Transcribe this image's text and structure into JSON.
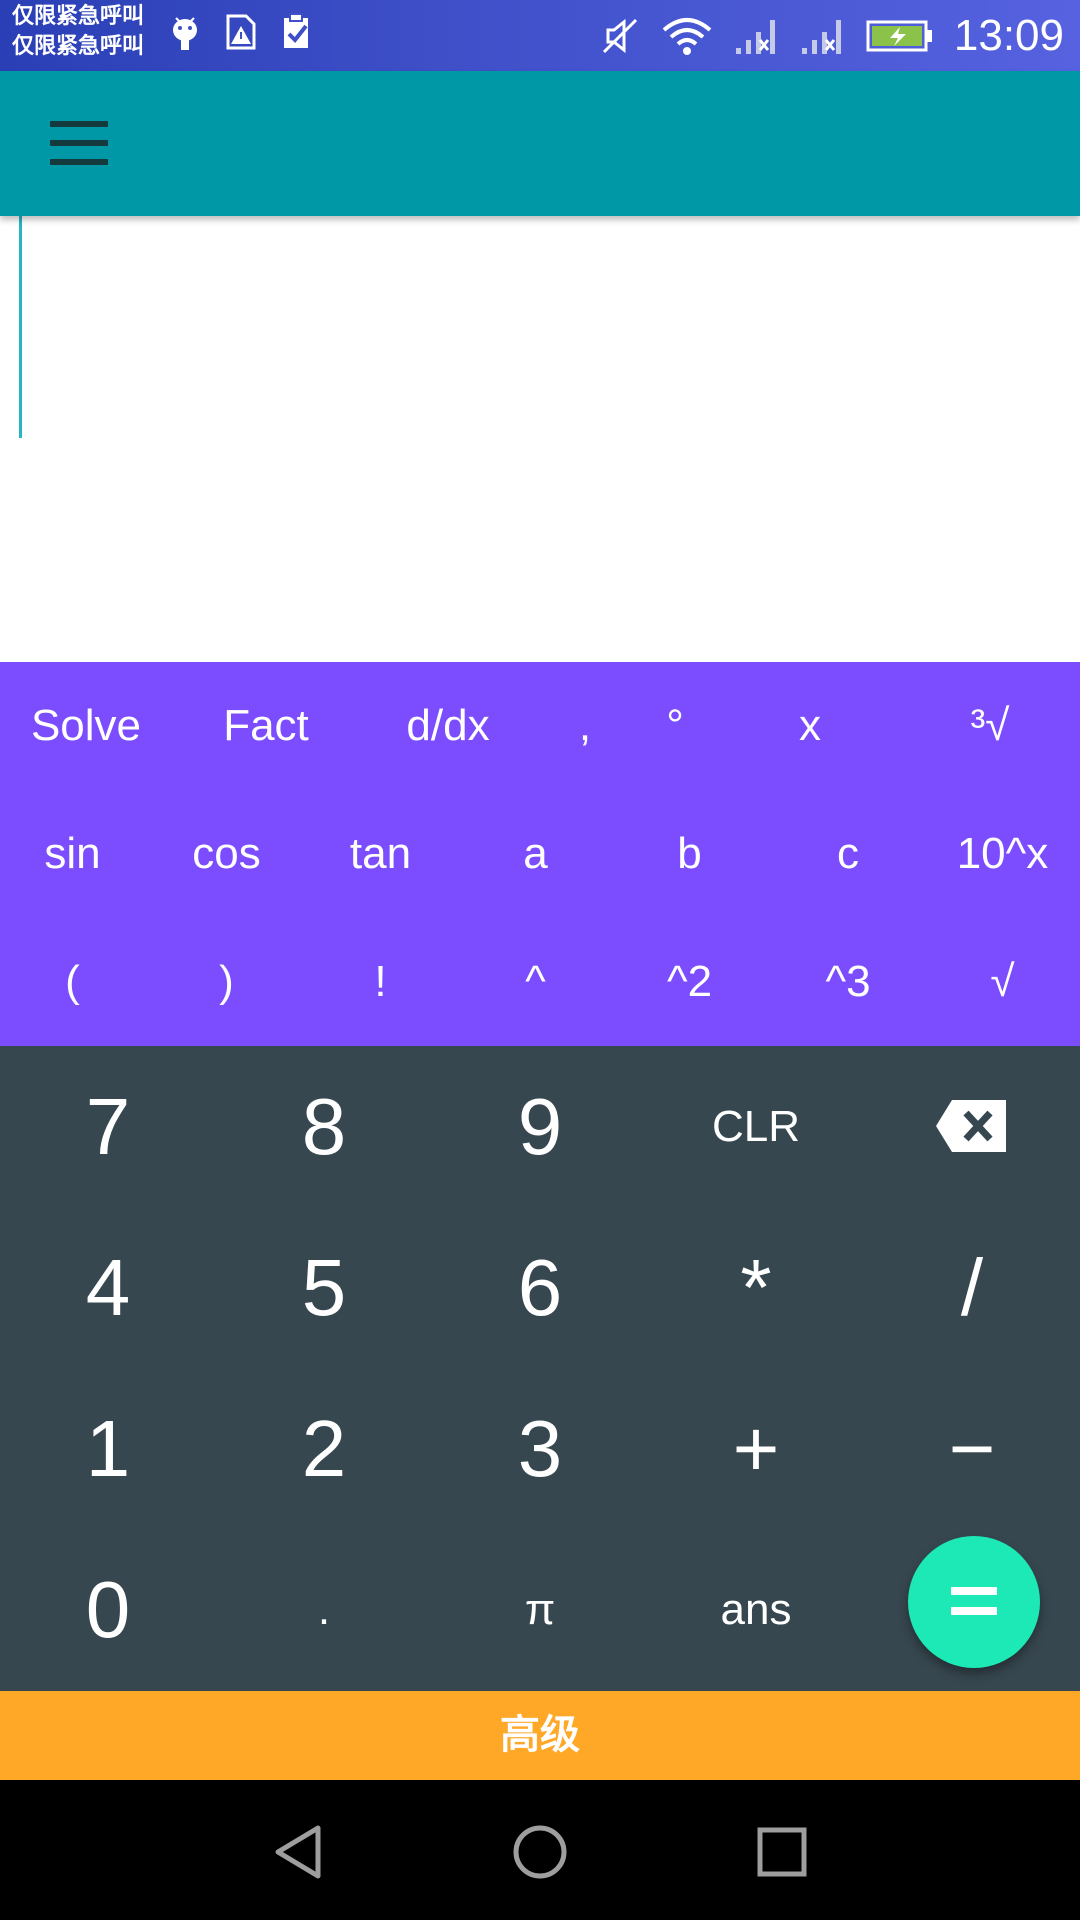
{
  "status_bar": {
    "carrier_line1": "仅限紧急呼叫",
    "carrier_line2": "仅限紧急呼叫",
    "time": "13:09",
    "icons": [
      "android-icon",
      "sim-warning-icon",
      "clipboard-check-icon",
      "mute-icon",
      "wifi-icon",
      "signal-x-icon",
      "signal-x-icon",
      "battery-charging-icon"
    ]
  },
  "app_bar": {
    "menu_icon": "menu-icon"
  },
  "display": {
    "expression": ""
  },
  "advanced_keys": {
    "row1": [
      "Solve",
      "Fact",
      "d/dx",
      ",",
      "°",
      "x",
      "³√"
    ],
    "row2": [
      "sin",
      "cos",
      "tan",
      "a",
      "b",
      "c",
      "10^x"
    ],
    "row3": [
      "(",
      ")",
      "!",
      "^",
      "^2",
      "^3",
      "√"
    ]
  },
  "numpad": {
    "row1": [
      "7",
      "8",
      "9",
      "CLR"
    ],
    "backspace_icon": "backspace-icon",
    "row2": [
      "4",
      "5",
      "6",
      "*",
      "/"
    ],
    "row3": [
      "1",
      "2",
      "3",
      "+",
      "−"
    ],
    "row4": [
      "0",
      ".",
      "π",
      "ans"
    ],
    "equals_icon": "equals-icon"
  },
  "advanced_toggle": {
    "label": "高级"
  },
  "colors": {
    "status_bar": "#3e4fc8",
    "app_bar": "#0097a7",
    "advanced_panel": "#7c4dff",
    "numpad": "#37474f",
    "equals_fab": "#1de9b6",
    "advanced_toggle": "#ffa726",
    "nav_bar": "#000000"
  }
}
